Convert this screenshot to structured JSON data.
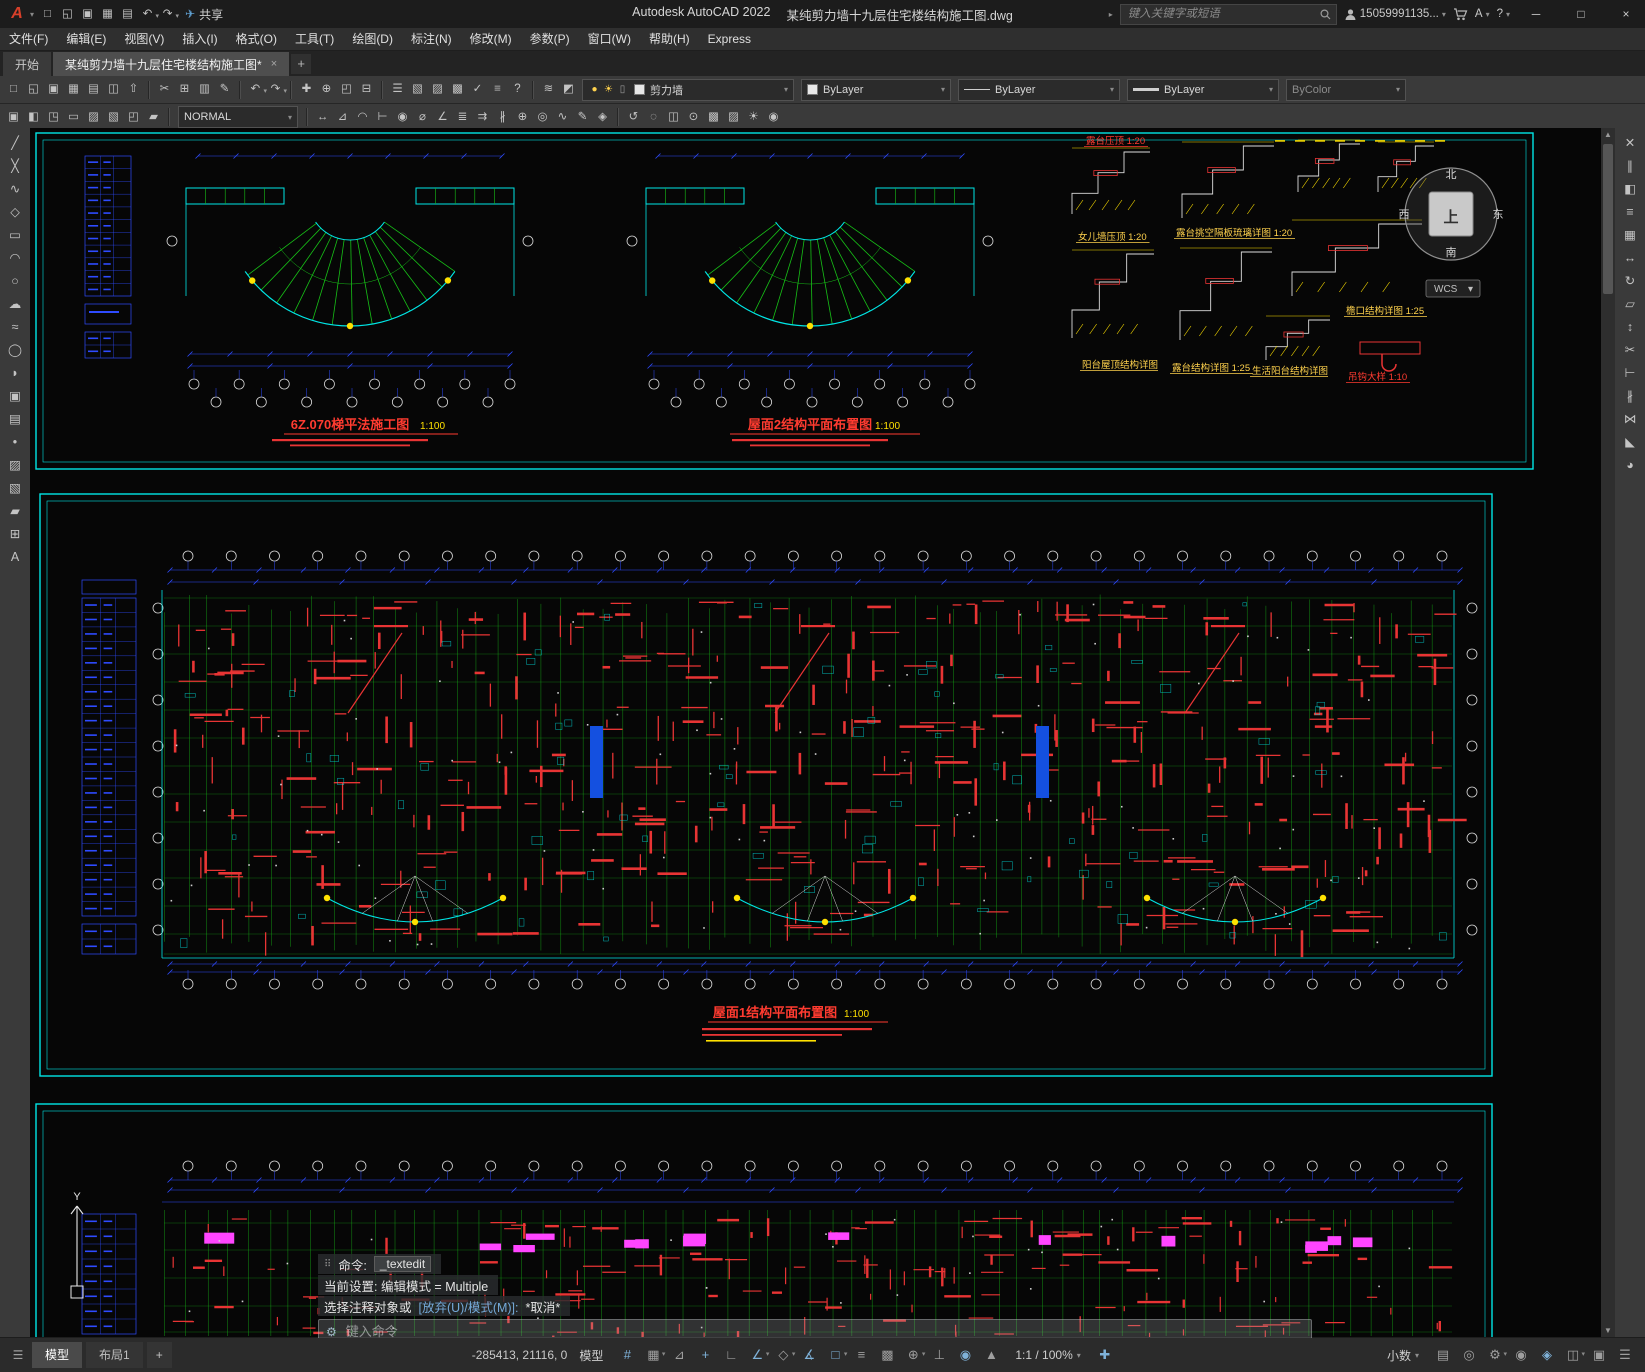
{
  "ui": {
    "caret": "▾",
    "caret_right": "▸"
  },
  "titlebar": {
    "logo_letter": "A",
    "qat": [
      {
        "name": "qat-new",
        "glyph": "□"
      },
      {
        "name": "qat-open",
        "glyph": "◱"
      },
      {
        "name": "qat-save",
        "glyph": "▣"
      },
      {
        "name": "qat-save-as",
        "glyph": "▦"
      },
      {
        "name": "qat-plot",
        "glyph": "▤"
      },
      {
        "name": "qat-undo",
        "glyph": "↶",
        "caret": true
      },
      {
        "name": "qat-redo",
        "glyph": "↷",
        "caret": true
      }
    ],
    "share": {
      "glyph": "✈",
      "label": "共享"
    },
    "app_title": "Autodesk AutoCAD 2022",
    "doc_title": "某纯剪力墙十九层住宅楼结构施工图.dwg",
    "search_placeholder": "键入关键字或短语",
    "account": "15059991135...",
    "help_label": "?",
    "win_min": "─",
    "win_max": "□",
    "win_close": "×"
  },
  "menubar": {
    "items": [
      "文件(F)",
      "编辑(E)",
      "视图(V)",
      "插入(I)",
      "格式(O)",
      "工具(T)",
      "绘图(D)",
      "标注(N)",
      "修改(M)",
      "参数(P)",
      "窗口(W)",
      "帮助(H)",
      "Express"
    ]
  },
  "filetabs": {
    "start": "开始",
    "drawing": "某纯剪力墙十九层住宅楼结构施工图*",
    "close_glyph": "×",
    "new_tab": "+"
  },
  "toolbar1": {
    "icons": [
      {
        "name": "new",
        "glyph": "□"
      },
      {
        "name": "open",
        "glyph": "◱"
      },
      {
        "name": "save",
        "glyph": "▣"
      },
      {
        "name": "save-as",
        "glyph": "▦"
      },
      {
        "name": "plot",
        "glyph": "▤"
      },
      {
        "name": "plot-preview",
        "glyph": "◫"
      },
      {
        "name": "publish",
        "glyph": "⇧"
      },
      {
        "sep": true
      },
      {
        "name": "cut",
        "glyph": "✂"
      },
      {
        "name": "copy-clip",
        "glyph": "⊞"
      },
      {
        "name": "paste",
        "glyph": "▥"
      },
      {
        "name": "match-properties",
        "glyph": "✎"
      },
      {
        "sep": true
      },
      {
        "name": "undo",
        "glyph": "↶",
        "caret": true
      },
      {
        "name": "redo",
        "glyph": "↷",
        "caret": true
      },
      {
        "sep": true
      },
      {
        "name": "pan",
        "glyph": "✚"
      },
      {
        "name": "zoom-realtime",
        "glyph": "⊕"
      },
      {
        "name": "zoom-window",
        "glyph": "◰"
      },
      {
        "name": "zoom-previous",
        "glyph": "⊟"
      },
      {
        "sep": true
      },
      {
        "name": "properties-palette",
        "glyph": "☰"
      },
      {
        "name": "designcenter",
        "glyph": "▧"
      },
      {
        "name": "tool-palettes",
        "glyph": "▨"
      },
      {
        "name": "sheet-set-manager",
        "glyph": "▩"
      },
      {
        "name": "markup-set-manager",
        "glyph": "✓"
      },
      {
        "name": "quickcalc",
        "glyph": "≡"
      },
      {
        "name": "help",
        "glyph": "?"
      }
    ],
    "layer_tools": [
      {
        "name": "layer-properties",
        "glyph": "≋"
      },
      {
        "name": "layer-states",
        "glyph": "◩"
      }
    ],
    "layer_status": [
      {
        "name": "layer-on",
        "glyph": "●",
        "color": "#ffd24d"
      },
      {
        "name": "layer-thaw",
        "glyph": "☀",
        "color": "#ffd24d"
      },
      {
        "name": "layer-lock",
        "glyph": "▯",
        "color": "#9a9a9a"
      }
    ],
    "layer_name": "剪力墙",
    "color": "ByLayer",
    "linetype": "ByLayer",
    "lineweight": "ByLayer",
    "plot_style": "ByColor"
  },
  "toolbar2": {
    "icons_a": [
      {
        "name": "insert-block",
        "glyph": "▣"
      },
      {
        "name": "block-editor",
        "glyph": "◧"
      },
      {
        "name": "attach-xref",
        "glyph": "◳"
      },
      {
        "name": "attach-image",
        "glyph": "▭"
      },
      {
        "name": "hatch",
        "glyph": "▨"
      },
      {
        "name": "gradient",
        "glyph": "▧"
      },
      {
        "name": "boundary",
        "glyph": "◰"
      },
      {
        "name": "region",
        "glyph": "▰"
      }
    ],
    "text_style": "NORMAL",
    "icons_b": [
      {
        "name": "dim-linear",
        "glyph": "↔"
      },
      {
        "name": "dim-aligned",
        "glyph": "⊿"
      },
      {
        "name": "dim-arc-length",
        "glyph": "◠"
      },
      {
        "name": "dim-ordinate",
        "glyph": "⊢"
      },
      {
        "name": "dim-radius",
        "glyph": "◉"
      },
      {
        "name": "dim-diameter",
        "glyph": "⌀"
      },
      {
        "name": "dim-angular",
        "glyph": "∠"
      },
      {
        "name": "quick-dimension",
        "glyph": "≣"
      },
      {
        "name": "dim-continue",
        "glyph": "⇉"
      },
      {
        "name": "dim-space",
        "glyph": "∦"
      },
      {
        "name": "tolerance",
        "glyph": "⊕"
      },
      {
        "name": "center-mark",
        "glyph": "◎"
      },
      {
        "name": "dim-jogged",
        "glyph": "∿"
      },
      {
        "name": "dimension-edit",
        "glyph": "✎"
      },
      {
        "name": "dim-style",
        "glyph": "◈"
      }
    ],
    "icons_c": [
      {
        "name": "redraw",
        "glyph": "↺"
      },
      {
        "name": "regen",
        "glyph": "◌"
      },
      {
        "name": "named-views",
        "glyph": "◫"
      },
      {
        "name": "orbit",
        "glyph": "⊙"
      },
      {
        "name": "render",
        "glyph": "▩"
      },
      {
        "name": "materials",
        "glyph": "▨"
      },
      {
        "name": "lights",
        "glyph": "☀"
      },
      {
        "name": "camera",
        "glyph": "◉"
      }
    ]
  },
  "left_rail": {
    "icons": [
      {
        "name": "line",
        "glyph": "╱"
      },
      {
        "name": "construction-line",
        "glyph": "╳"
      },
      {
        "name": "polyline",
        "glyph": "∿"
      },
      {
        "name": "polygon",
        "glyph": "◇"
      },
      {
        "name": "rectangle",
        "glyph": "▭"
      },
      {
        "name": "arc",
        "glyph": "◠"
      },
      {
        "name": "circle",
        "glyph": "○"
      },
      {
        "name": "revision-cloud",
        "glyph": "☁"
      },
      {
        "name": "spline",
        "glyph": "≈"
      },
      {
        "name": "ellipse",
        "glyph": "◯"
      },
      {
        "name": "ellipse-arc",
        "glyph": "◗"
      },
      {
        "name": "insert",
        "glyph": "▣"
      },
      {
        "name": "make-block",
        "glyph": "▤"
      },
      {
        "name": "point",
        "glyph": "•"
      },
      {
        "name": "hatch-draw",
        "glyph": "▨"
      },
      {
        "name": "gradient-draw",
        "glyph": "▧"
      },
      {
        "name": "region-draw",
        "glyph": "▰"
      },
      {
        "name": "table",
        "glyph": "⊞"
      },
      {
        "name": "multiline-text",
        "glyph": "A"
      }
    ]
  },
  "right_rail": {
    "icons": [
      {
        "name": "erase",
        "glyph": "✕"
      },
      {
        "name": "copy-object",
        "glyph": "∥"
      },
      {
        "name": "mirror",
        "glyph": "◧"
      },
      {
        "name": "offset",
        "glyph": "≡"
      },
      {
        "name": "array",
        "glyph": "▦"
      },
      {
        "name": "move",
        "glyph": "↔"
      },
      {
        "name": "rotate",
        "glyph": "↻"
      },
      {
        "name": "scale-tool",
        "glyph": "▱"
      },
      {
        "name": "stretch",
        "glyph": "↕"
      },
      {
        "name": "trim",
        "glyph": "✂"
      },
      {
        "name": "extend",
        "glyph": "⊢"
      },
      {
        "name": "break",
        "glyph": "∦"
      },
      {
        "name": "join",
        "glyph": "⋈"
      },
      {
        "name": "chamfer",
        "glyph": "◣"
      },
      {
        "name": "fillet",
        "glyph": "◕"
      }
    ]
  },
  "scrollbar": {
    "up": "▲",
    "down": "▼"
  },
  "canvas": {
    "titles": [
      {
        "text": "6Z.070梯平法施工图",
        "scale": "1:100"
      },
      {
        "text": "屋面2结构平面布置图",
        "scale": "1:100"
      },
      {
        "text": "屋面1结构平面布置图",
        "scale": "1:100"
      }
    ],
    "details": [
      {
        "label": "露台压顶",
        "scale": "1:20",
        "color": "red"
      },
      {
        "label": "女儿墙压顶",
        "scale": "1:20",
        "color": "yellow"
      },
      {
        "label": "露台挑空隔板琉璃详图",
        "scale": "1:20",
        "color": "yellow"
      },
      {
        "label": "檐口结构详图",
        "scale": "1:25",
        "color": "yellow"
      },
      {
        "label": "阳台屋顶结构详图",
        "scale": "",
        "color": "yellow"
      },
      {
        "label": "露台结构详图",
        "scale": "1:25",
        "color": "yellow"
      },
      {
        "label": "生活阳台结构详图",
        "scale": "",
        "color": "yellow"
      },
      {
        "label": "吊钩大样",
        "scale": "1:10",
        "color": "red"
      }
    ],
    "viewcube": {
      "north": "北",
      "south": "南",
      "east": "东",
      "west": "西",
      "up": "上",
      "wcs": "WCS"
    },
    "ucs_axis": "Y"
  },
  "commandline": {
    "grip": "⠿",
    "prompt_label": "命令:",
    "current_command": "_textedit",
    "line2": "当前设置: 编辑模式 = Multiple",
    "line3_pre": "选择注释对象或",
    "line3_options": "[放弃(U)/模式(M)]:",
    "line3_post": "*取消*",
    "placeholder": "键入命令",
    "tool_glyph": "⚙"
  },
  "statusbar": {
    "menu_glyph": "☰",
    "model_tab": "模型",
    "layout_tab": "布局1",
    "add_layout": "+",
    "coords": "-285413, 21116, 0",
    "model_space": "模型",
    "toggles": [
      {
        "name": "grid-display",
        "glyph": "#",
        "on": true
      },
      {
        "name": "snap-mode",
        "glyph": "▦",
        "caret": true
      },
      {
        "name": "infer-constraints",
        "glyph": "⊿"
      },
      {
        "name": "dynamic-input",
        "glyph": "+",
        "on": true
      },
      {
        "name": "ortho-mode",
        "glyph": "∟"
      },
      {
        "name": "polar-tracking",
        "glyph": "∠",
        "caret": true,
        "on": true
      },
      {
        "name": "isometric-drafting",
        "glyph": "◇",
        "caret": true
      },
      {
        "name": "object-snap-tracking",
        "glyph": "∡",
        "on": true
      },
      {
        "name": "object-snap",
        "glyph": "□",
        "caret": true,
        "on": true
      },
      {
        "name": "lineweight-display",
        "glyph": "≡"
      },
      {
        "name": "transparency",
        "glyph": "▩"
      },
      {
        "name": "selection-cycling",
        "glyph": "⊕",
        "caret": true
      },
      {
        "name": "dynamic-ucs",
        "glyph": "⊥"
      },
      {
        "name": "annotation-visibility",
        "glyph": "◉",
        "on": true
      },
      {
        "name": "autoscale",
        "glyph": "▲"
      }
    ],
    "scale": "1:1 / 100%",
    "ann_icons": [
      {
        "name": "annotation-scale-sync",
        "glyph": "✚",
        "on": true
      }
    ],
    "units": "小数",
    "right_icons": [
      {
        "name": "quick-properties",
        "glyph": "▤"
      },
      {
        "name": "object-isolate",
        "glyph": "◎"
      },
      {
        "name": "workspace-switching",
        "glyph": "⚙",
        "caret": true
      },
      {
        "name": "annotation-monitor",
        "glyph": "◉"
      },
      {
        "name": "graphics-performance",
        "glyph": "◈",
        "on": true
      },
      {
        "name": "lock-ui",
        "glyph": "◫",
        "caret": true
      },
      {
        "name": "clean-screen",
        "glyph": "▣"
      },
      {
        "name": "customization",
        "glyph": "☰"
      }
    ]
  },
  "colors": {
    "cyan": "#00e5e5",
    "green": "#17c117",
    "red": "#e83434",
    "blue": "#2e4bff",
    "yellow": "#ffe100",
    "magenta": "#ff45ff",
    "white": "#e0e0e0",
    "title_red": "#ff3b30",
    "label_yellow": "#ffd24d"
  }
}
